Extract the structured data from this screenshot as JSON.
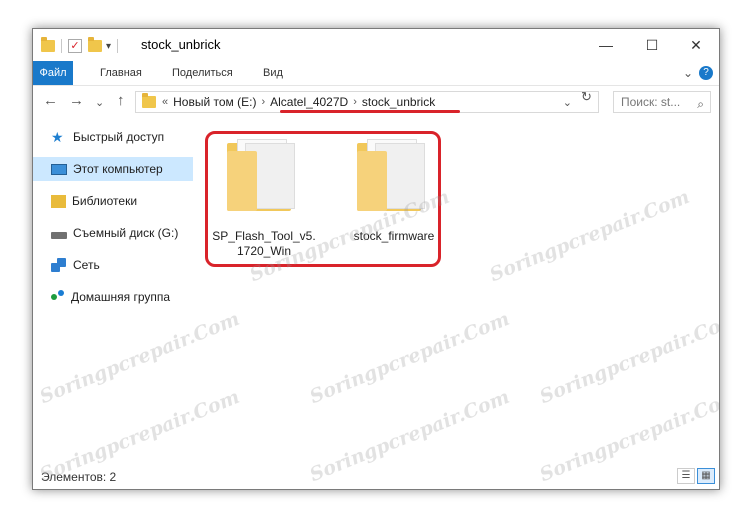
{
  "window": {
    "title": "stock_unbrick"
  },
  "window_controls": {
    "minimize": "—",
    "maximize": "☐",
    "close": "✕"
  },
  "ribbon": {
    "tabs": [
      "Файл",
      "Главная",
      "Поделиться",
      "Вид"
    ],
    "expand": "⌄",
    "help": "?"
  },
  "nav": {
    "back": "←",
    "forward": "→",
    "recent": "⌄",
    "up": "↑",
    "breadcrumbs": [
      "Новый том (E:)",
      "Alcatel_4027D",
      "stock_unbrick"
    ],
    "overflow": "«",
    "search_placeholder": "Поиск: st..."
  },
  "sidebar": {
    "items": [
      {
        "label": "Быстрый доступ",
        "icon": "star-icon"
      },
      {
        "label": "Этот компьютер",
        "icon": "computer-icon"
      },
      {
        "label": "Библиотеки",
        "icon": "library-icon"
      },
      {
        "label": "Съемный диск (G:)",
        "icon": "usb-drive-icon"
      },
      {
        "label": "Сеть",
        "icon": "network-icon"
      },
      {
        "label": "Домашняя группа",
        "icon": "homegroup-icon"
      }
    ]
  },
  "files": [
    {
      "name": "SP_Flash_Tool_v5.1720_Win",
      "line1": "SP_Flash_Tool_v5.",
      "line2": "1720_Win"
    },
    {
      "name": "stock_firmware",
      "line1": "stock_firmware",
      "line2": ""
    }
  ],
  "status": {
    "items_count": "Элементов: 2"
  },
  "watermark": "Soringpcrepair.Com"
}
